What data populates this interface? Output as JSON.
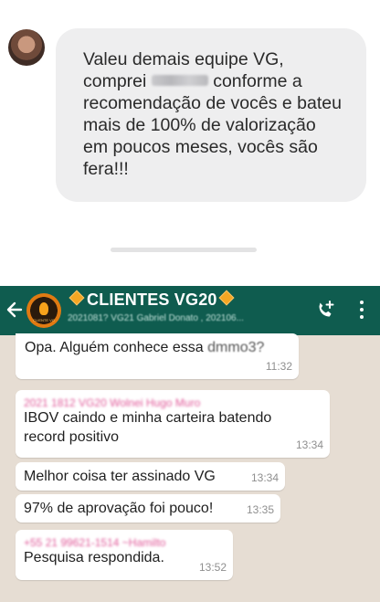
{
  "testimonial": {
    "text_before": "Valeu demais equipe VG, comprei",
    "text_after": "conforme a recomendação de vocês e bateu mais de 100% de valorização em poucos meses, vocês são fera!!!"
  },
  "header": {
    "title": "CLIENTES VG20",
    "subtitle": "2021081? VG21 Gabriel Donato , 202106...",
    "avatar_text": "CLIENTE VG"
  },
  "messages": [
    {
      "text": "Opa. Alguém conhece essa",
      "blurred": "dmmo3?",
      "time": "11:32"
    },
    {
      "sender": "2021 1812 VG20 Wolnei Hugo Muro",
      "text": "IBOV caindo e minha carteira batendo record positivo",
      "time": "13:34"
    },
    {
      "text": "Melhor coisa ter assinado VG",
      "time": "13:34"
    },
    {
      "text": "97% de aprovação foi pouco!",
      "time": "13:35"
    },
    {
      "sender": "+55 21 99621-1514   ~Hamilto",
      "text": "Pesquisa respondida.",
      "time": "13:52"
    }
  ],
  "colors": {
    "header_bg": "#0f5c4f",
    "chat_bg": "#e6ddd3",
    "bubble_grey": "#eeeeef",
    "sender_pink": "#e15b9a"
  },
  "icons": [
    "back-arrow-icon",
    "group-avatar-icon",
    "add-call-icon",
    "more-vert-icon",
    "diamond-icon"
  ]
}
